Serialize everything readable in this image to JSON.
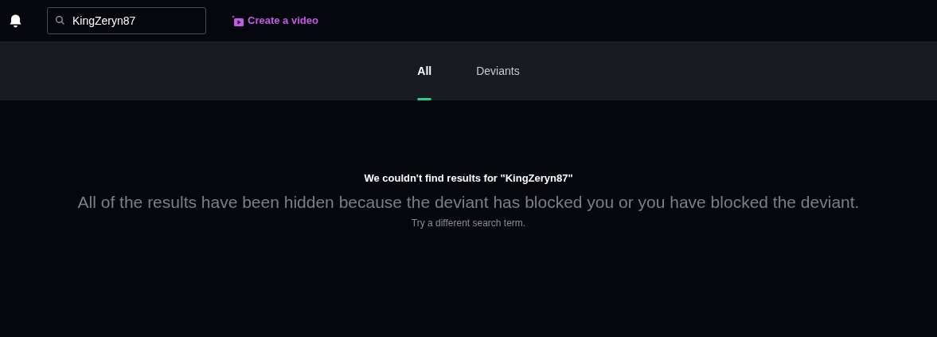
{
  "header": {
    "search": {
      "value": "KingZeryn87"
    },
    "create_button": "Create a video"
  },
  "tabs": [
    {
      "label": "All",
      "selected": true
    },
    {
      "label": "Deviants",
      "selected": false
    }
  ],
  "empty_state": {
    "title": "We couldn't find results for \"KingZeryn87\"",
    "message": "All of the results have been hidden because the deviant has blocked you or you have blocked the deviant.",
    "hint": "Try a different search term."
  }
}
